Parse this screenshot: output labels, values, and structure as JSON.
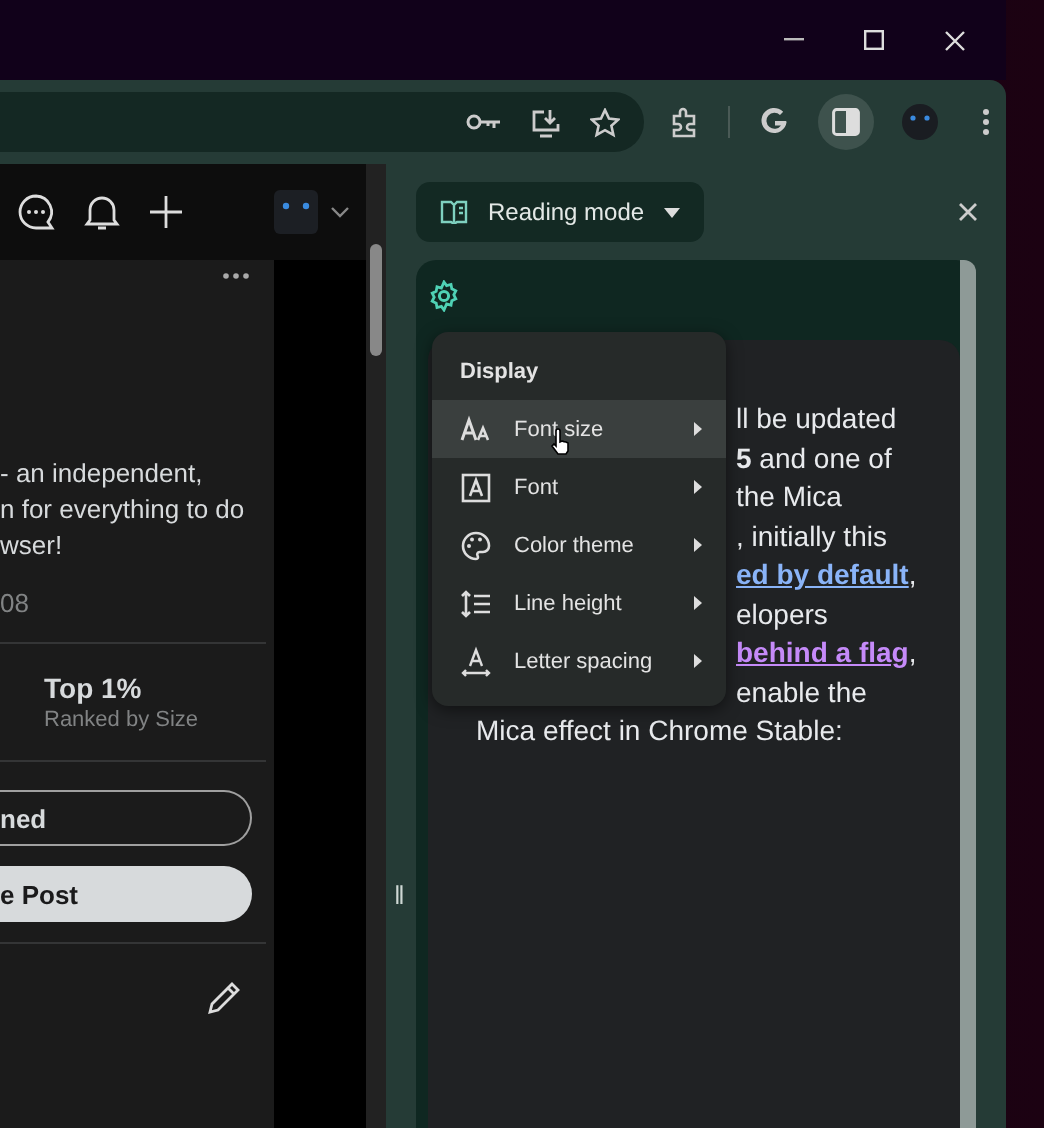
{
  "toolbar": {
    "side_panel_active": true
  },
  "page": {
    "lines": [
      "- an independent,",
      "n for everything to do",
      "wser!"
    ],
    "stat_value": "08",
    "rank": {
      "value": "Top 1%",
      "label": "Ranked by Size"
    },
    "buttons": [
      {
        "label": "ned",
        "kind": "outline"
      },
      {
        "label": "e Post",
        "kind": "filled"
      }
    ]
  },
  "side_panel": {
    "mode": "Reading mode",
    "handle": "‖",
    "beside_menu": [
      {
        "text": "ll be updated",
        "kind": "text"
      },
      {
        "text": "**5** and one of",
        "kind": "text"
      },
      {
        "text": "the Mica",
        "kind": "text"
      },
      {
        "text": ", initially this",
        "kind": "text"
      },
      {
        "text": "ed by default",
        "kind": "link",
        "tail": ","
      },
      {
        "text": "elopers",
        "kind": "text"
      },
      {
        "text": "behind a flag",
        "kind": "visited-link",
        "tail": ","
      },
      {
        "text": "enable the",
        "kind": "text"
      }
    ],
    "below_menu": [
      "Mica effect in Chrome Stable:"
    ],
    "menu": {
      "title": "Display",
      "items": [
        {
          "label": "Font size",
          "selected": true
        },
        {
          "label": "Font",
          "selected": false
        },
        {
          "label": "Color theme",
          "selected": false
        },
        {
          "label": "Line height",
          "selected": false
        },
        {
          "label": "Letter spacing",
          "selected": false
        }
      ]
    }
  }
}
